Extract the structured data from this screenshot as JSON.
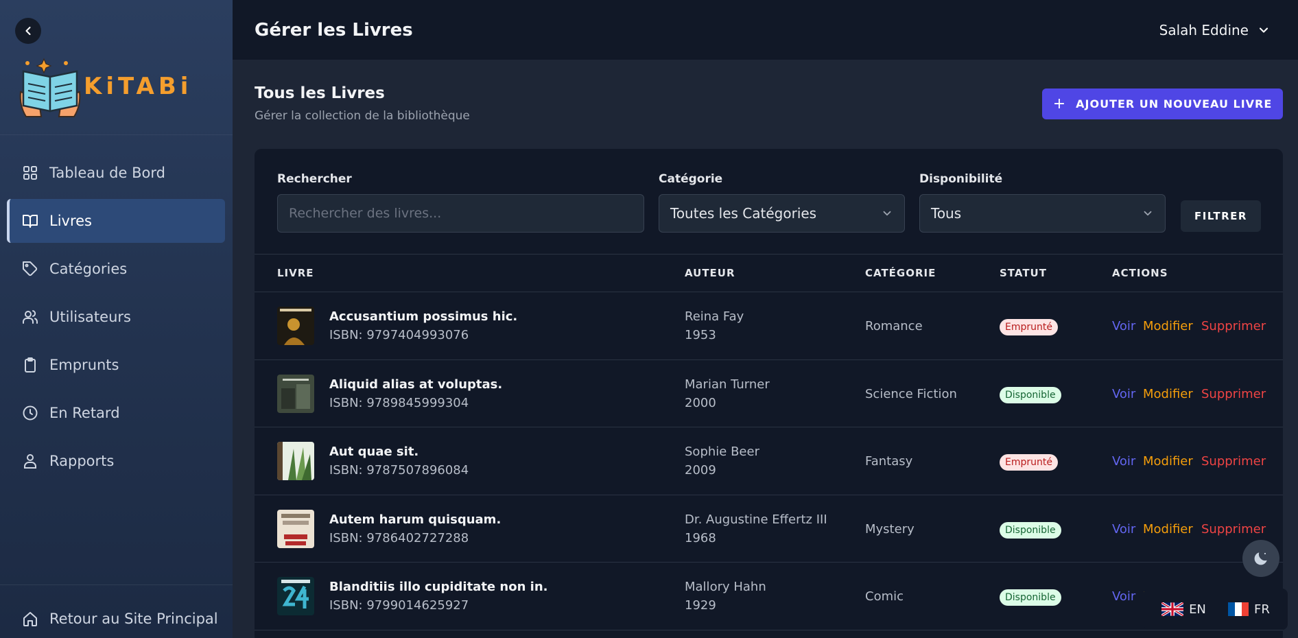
{
  "brand": {
    "name": "KiTABi"
  },
  "sidebar": {
    "items": [
      {
        "label": "Tableau de Bord",
        "icon": "grid-icon",
        "active": false
      },
      {
        "label": "Livres",
        "icon": "book-open-icon",
        "active": true
      },
      {
        "label": "Catégories",
        "icon": "tag-icon",
        "active": false
      },
      {
        "label": "Utilisateurs",
        "icon": "users-icon",
        "active": false
      },
      {
        "label": "Emprunts",
        "icon": "clipboard-icon",
        "active": false
      },
      {
        "label": "En Retard",
        "icon": "clock-icon",
        "active": false
      },
      {
        "label": "Rapports",
        "icon": "user-report-icon",
        "active": false
      }
    ],
    "bottom_label": "Retour au Site Principal"
  },
  "header": {
    "title": "Gérer les Livres",
    "user_name": "Salah Eddine"
  },
  "main": {
    "title": "Tous les Livres",
    "subtitle": "Gérer la collection de la bibliothèque",
    "add_button": "AJOUTER UN NOUVEAU LIVRE"
  },
  "filters": {
    "search_label": "Rechercher",
    "search_placeholder": "Rechercher des livres...",
    "category_label": "Catégorie",
    "category_value": "Toutes les Catégories",
    "availability_label": "Disponibilité",
    "availability_value": "Tous",
    "filter_button": "FILTRER"
  },
  "table": {
    "columns": [
      "LIVRE",
      "AUTEUR",
      "CATÉGORIE",
      "STATUT",
      "ACTIONS"
    ],
    "actions": {
      "view": "Voir",
      "edit": "Modifier",
      "delete": "Supprimer"
    },
    "rows": [
      {
        "title": "Accusantium possimus hic.",
        "isbn": "ISBN: 9797404993076",
        "author": "Reina Fay",
        "year": "1953",
        "category": "Romance",
        "status": "Emprunté",
        "status_type": "borrowed",
        "cover_color": "#2a2418"
      },
      {
        "title": "Aliquid alias at voluptas.",
        "isbn": "ISBN: 9789845999304",
        "author": "Marian Turner",
        "year": "2000",
        "category": "Science Fiction",
        "status": "Disponible",
        "status_type": "available",
        "cover_color": "#4a5548"
      },
      {
        "title": "Aut quae sit.",
        "isbn": "ISBN: 9787507896084",
        "author": "Sophie Beer",
        "year": "2009",
        "category": "Fantasy",
        "status": "Emprunté",
        "status_type": "borrowed",
        "cover_color": "#4b7a3a"
      },
      {
        "title": "Autem harum quisquam.",
        "isbn": "ISBN: 9786402727288",
        "author": "Dr. Augustine Effertz III",
        "year": "1968",
        "category": "Mystery",
        "status": "Disponible",
        "status_type": "available",
        "cover_color": "#e8ddd0"
      },
      {
        "title": "Blanditiis illo cupiditate non in.",
        "isbn": "ISBN: 9799014625927",
        "author": "Mallory Hahn",
        "year": "1929",
        "category": "Comic",
        "status": "Disponible",
        "status_type": "available",
        "cover_color": "#0c2b33"
      }
    ]
  },
  "languages": [
    {
      "code": "EN"
    },
    {
      "code": "FR"
    }
  ],
  "colors": {
    "accent": "#4f46e5",
    "view": "#6366f1",
    "edit": "#f59e0b",
    "delete": "#ef4444"
  }
}
